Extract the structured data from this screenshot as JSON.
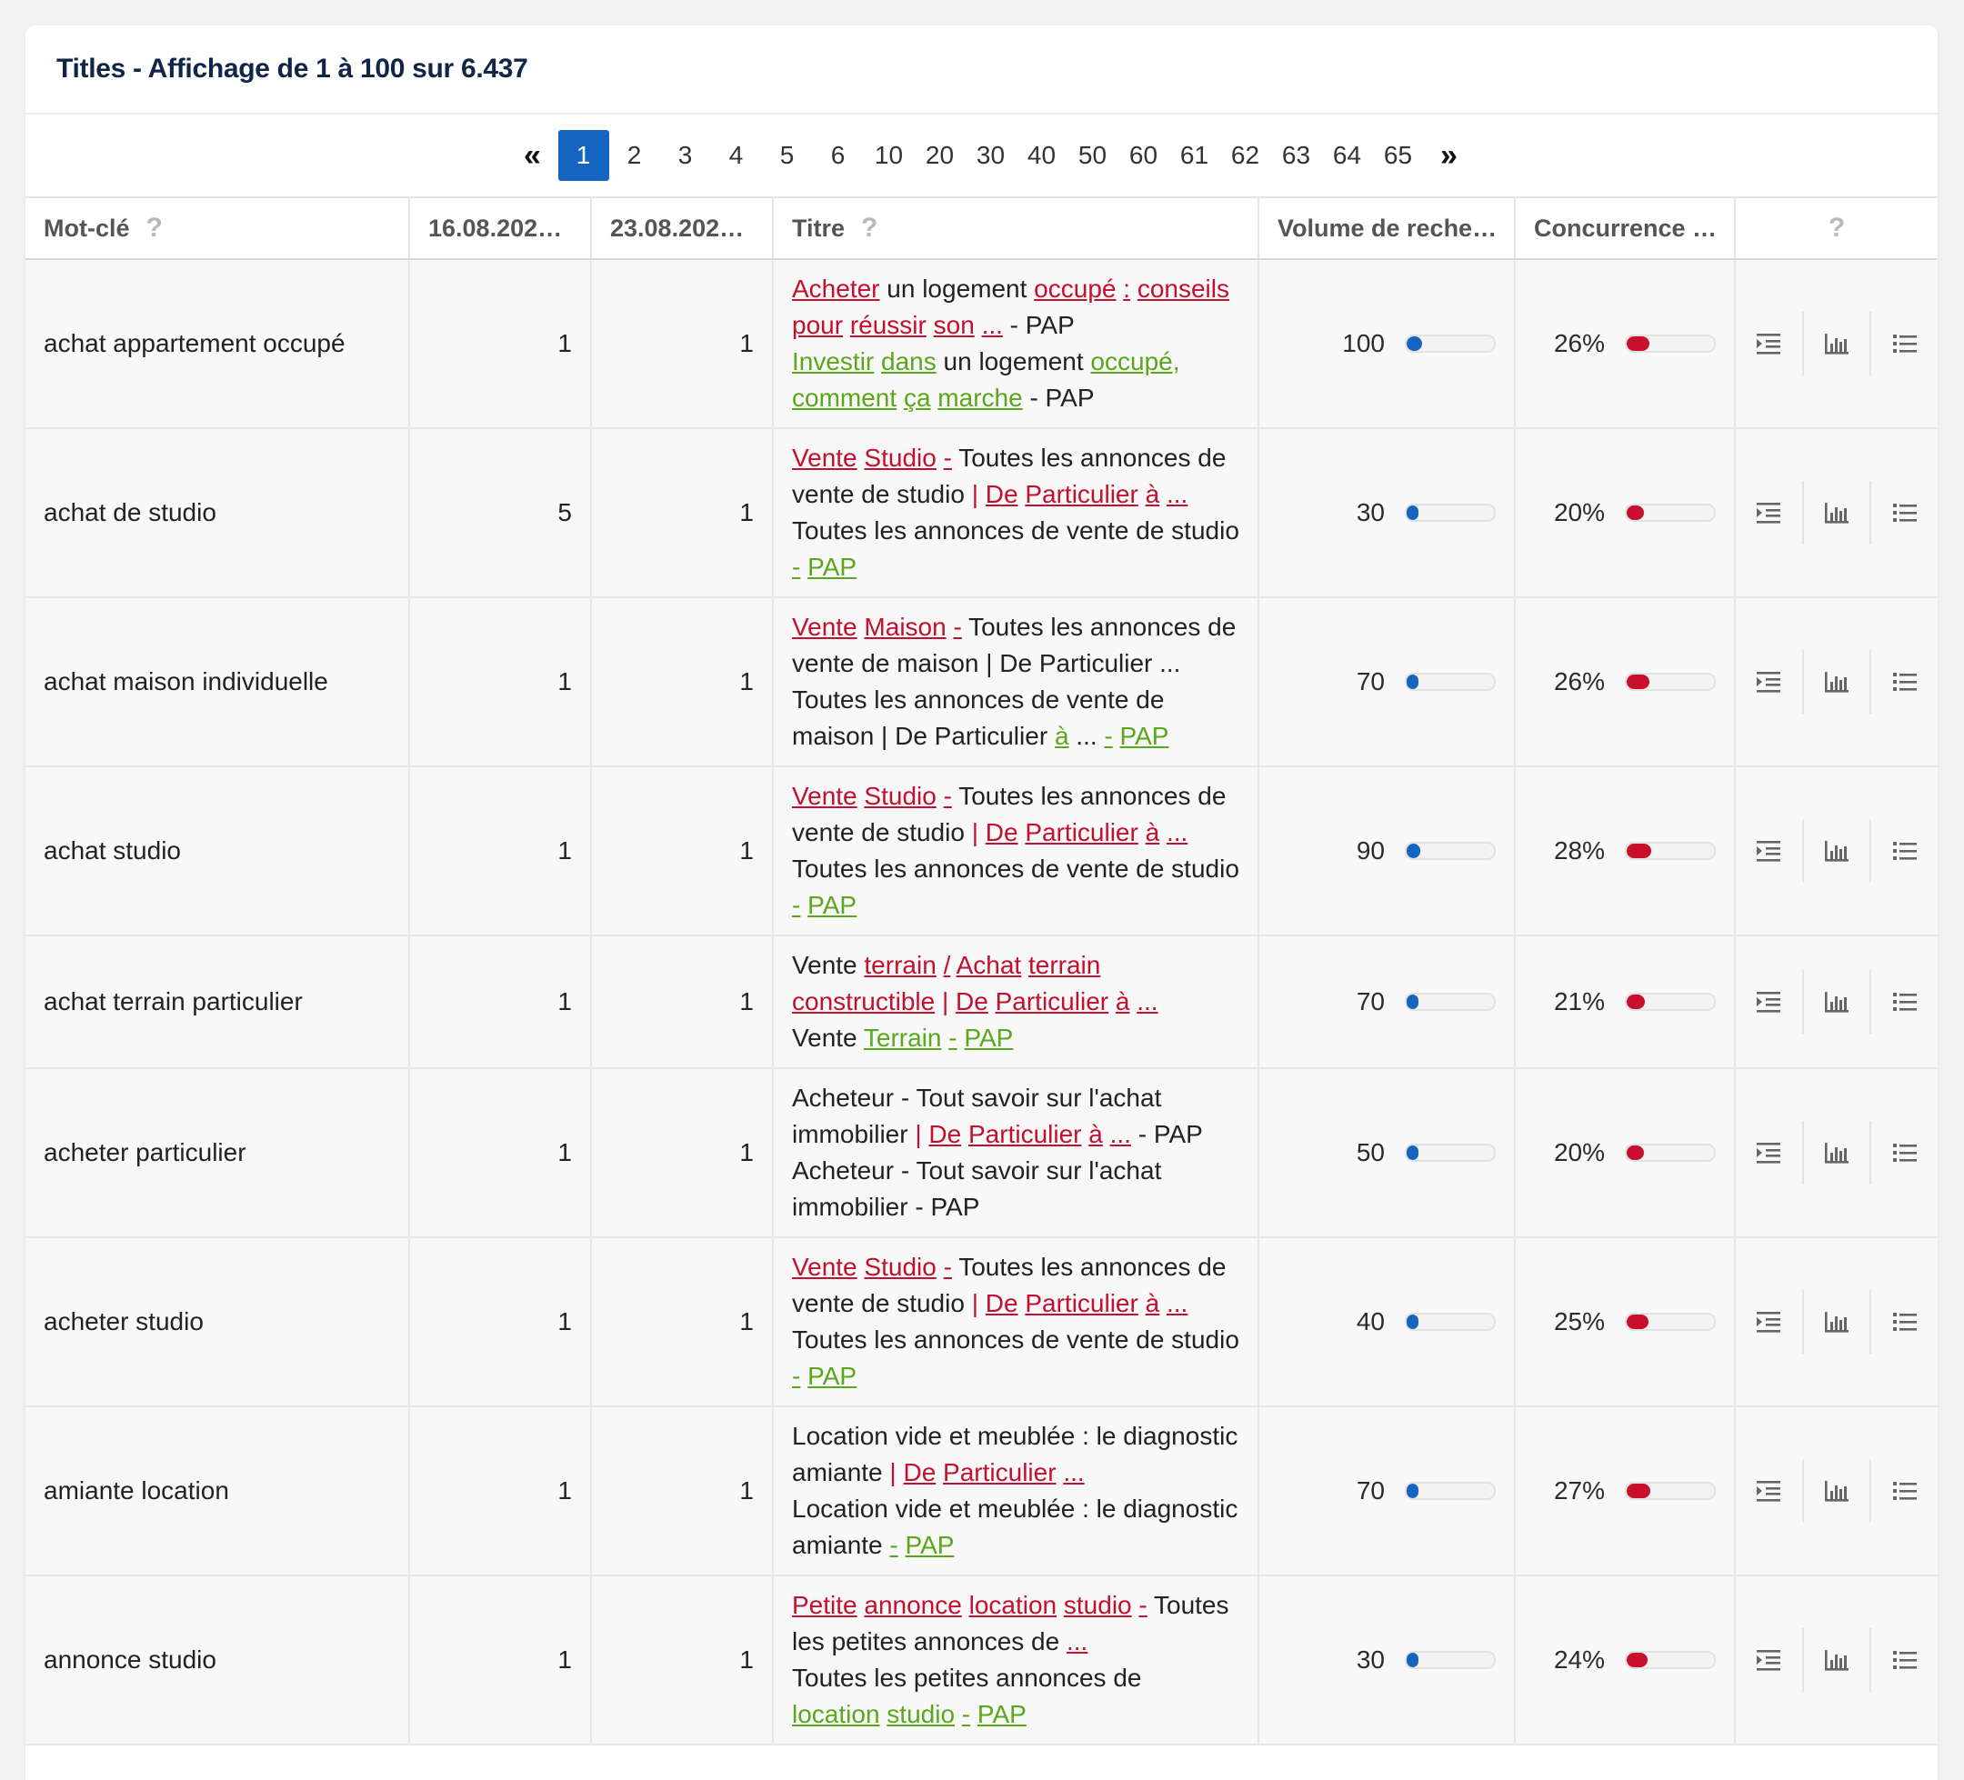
{
  "header": {
    "title": "Titles - Affichage de 1 à 100 sur 6.437"
  },
  "pagination": {
    "prev_label": "«",
    "next_label": "»",
    "current": "1",
    "pages": [
      "1",
      "2",
      "3",
      "4",
      "5",
      "6",
      "10",
      "20",
      "30",
      "40",
      "50",
      "60",
      "61",
      "62",
      "63",
      "64",
      "65"
    ]
  },
  "columns": {
    "keyword": "Mot-clé",
    "date1": "16.08.202…",
    "date2": "23.08.202…",
    "title": "Titre",
    "volume": "Volume de reche…",
    "competition": "Concurrence …",
    "help": "?"
  },
  "icons": {
    "help": "question-mark-icon",
    "action1": "indent-list-icon",
    "action2": "bar-chart-icon",
    "action3": "bullet-list-icon"
  },
  "colors": {
    "accent": "#1565c0",
    "removed_words": "#c2102e",
    "added_words": "#5aa71b",
    "competition_bar": "#c8102e"
  },
  "rows": [
    {
      "keyword": "achat appartement occupé",
      "rank1": "1",
      "rank2": "1",
      "volume": "100",
      "volume_level": 0.18,
      "competition": "26%",
      "competition_level": 0.26,
      "title_html": "<span class=\"r\">Acheter</span> un logement <span class=\"r\">occupé</span> <span class=\"r\">:</span> <span class=\"r\">conseils</span><br><span class=\"r\">pour</span> <span class=\"r\">réussir</span> <span class=\"r\">son</span> <span class=\"r\">...</span> - PAP<br><span class=\"g\">Investir</span> <span class=\"g\">dans</span> un logement <span class=\"g\">occupé,</span><br><span class=\"g\">comment</span> <span class=\"g\">ça</span> <span class=\"g\">marche</span> - PAP"
    },
    {
      "keyword": "achat de studio",
      "rank1": "5",
      "rank2": "1",
      "volume": "30",
      "volume_level": 0.08,
      "competition": "20%",
      "competition_level": 0.2,
      "title_html": "<span class=\"r\">Vente</span> <span class=\"r\">Studio</span> <span class=\"r\">-</span> Toutes les annonces de<br>vente de studio <span style=\"color:#c2102e\">|</span> <span class=\"r\">De</span> <span class=\"r\">Particulier</span> <span class=\"r\">à</span> <span class=\"r\">...</span><br>Toutes les annonces de vente de studio<br><span class=\"g\">-</span> <span class=\"g\">PAP</span>"
    },
    {
      "keyword": "achat maison individuelle",
      "rank1": "1",
      "rank2": "1",
      "volume": "70",
      "volume_level": 0.14,
      "competition": "26%",
      "competition_level": 0.26,
      "title_html": "<span class=\"r\">Vente</span> <span class=\"r\">Maison</span> <span class=\"r\">-</span> Toutes les annonces de<br>vente de maison | De Particulier ...<br>Toutes les annonces de vente de<br>maison | De Particulier <span class=\"g\">à</span> ... <span class=\"g\">-</span> <span class=\"g\">PAP</span>"
    },
    {
      "keyword": "achat studio",
      "rank1": "1",
      "rank2": "1",
      "volume": "90",
      "volume_level": 0.16,
      "competition": "28%",
      "competition_level": 0.28,
      "title_html": "<span class=\"r\">Vente</span> <span class=\"r\">Studio</span> <span class=\"r\">-</span> Toutes les annonces de<br>vente de studio <span style=\"color:#c2102e\">|</span> <span class=\"r\">De</span> <span class=\"r\">Particulier</span> <span class=\"r\">à</span> <span class=\"r\">...</span><br>Toutes les annonces de vente de studio<br><span class=\"g\">-</span> <span class=\"g\">PAP</span>"
    },
    {
      "keyword": "achat terrain particulier",
      "rank1": "1",
      "rank2": "1",
      "volume": "70",
      "volume_level": 0.14,
      "competition": "21%",
      "competition_level": 0.21,
      "title_html": "Vente <span class=\"r\">terrain</span> <span class=\"r\">/</span> <span class=\"r\">Achat</span> <span class=\"r\">terrain</span><br><span class=\"r\">constructible</span> <span style=\"color:#c2102e\">|</span> <span class=\"r\">De</span> <span class=\"r\">Particulier</span> <span class=\"r\">à</span> <span class=\"r\">...</span><br>Vente <span class=\"g\">Terrain</span> <span class=\"g\">-</span> <span class=\"g\">PAP</span>"
    },
    {
      "keyword": "acheter particulier",
      "rank1": "1",
      "rank2": "1",
      "volume": "50",
      "volume_level": 0.1,
      "competition": "20%",
      "competition_level": 0.2,
      "title_html": "Acheteur - Tout savoir sur l'achat<br>immobilier <span style=\"color:#c2102e\">|</span> <span class=\"r\">De</span> <span class=\"r\">Particulier</span> <span class=\"r\">à</span> <span class=\"r\">...</span> - PAP<br>Acheteur - Tout savoir sur l'achat<br>immobilier - PAP"
    },
    {
      "keyword": "acheter studio",
      "rank1": "1",
      "rank2": "1",
      "volume": "40",
      "volume_level": 0.09,
      "competition": "25%",
      "competition_level": 0.25,
      "title_html": "<span class=\"r\">Vente</span> <span class=\"r\">Studio</span> <span class=\"r\">-</span> Toutes les annonces de<br>vente de studio <span style=\"color:#c2102e\">|</span> <span class=\"r\">De</span> <span class=\"r\">Particulier</span> <span class=\"r\">à</span> <span class=\"r\">...</span><br>Toutes les annonces de vente de studio<br><span class=\"g\">-</span> <span class=\"g\">PAP</span>"
    },
    {
      "keyword": "amiante location",
      "rank1": "1",
      "rank2": "1",
      "volume": "70",
      "volume_level": 0.14,
      "competition": "27%",
      "competition_level": 0.27,
      "title_html": "Location vide et meublée : le diagnostic<br>amiante <span style=\"color:#c2102e\">|</span> <span class=\"r\">De</span> <span class=\"r\">Particulier</span> <span class=\"r\">...</span><br>Location vide et meublée : le diagnostic<br>amiante <span class=\"g\">-</span> <span class=\"g\">PAP</span>"
    },
    {
      "keyword": "annonce studio",
      "rank1": "1",
      "rank2": "1",
      "volume": "30",
      "volume_level": 0.08,
      "competition": "24%",
      "competition_level": 0.24,
      "title_html": "<span class=\"r\">Petite</span> <span class=\"r\">annonce</span> <span class=\"r\">location</span> <span class=\"r\">studio</span> <span class=\"r\">-</span> Toutes<br>les petites annonces de <span class=\"r\">...</span><br>Toutes les petites annonces de<br><span class=\"g\">location</span> <span class=\"g\">studio</span> <span class=\"g\">-</span> <span class=\"g\">PAP</span>"
    }
  ]
}
